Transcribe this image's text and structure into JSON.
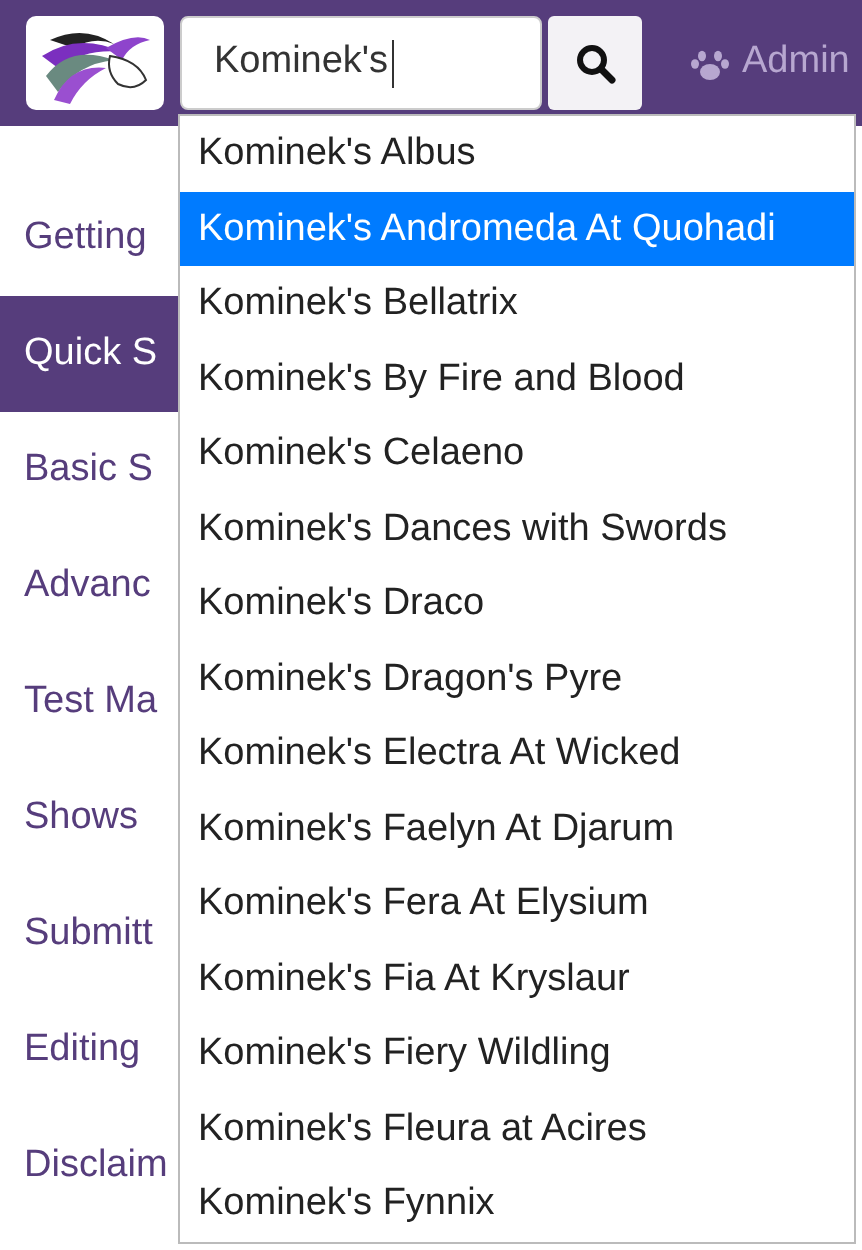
{
  "search": {
    "value": "Kominek's"
  },
  "nav_link": {
    "label": "Admin"
  },
  "sidebar": {
    "items": [
      {
        "label": "Getting",
        "selected": false
      },
      {
        "label": "Quick S",
        "selected": true
      },
      {
        "label": "Basic S",
        "selected": false
      },
      {
        "label": "Advanc",
        "selected": false
      },
      {
        "label": "Test Ma",
        "selected": false
      },
      {
        "label": "Shows",
        "selected": false
      },
      {
        "label": "Submitt",
        "selected": false
      },
      {
        "label": "Editing",
        "selected": false
      },
      {
        "label": "Disclaim",
        "selected": false
      }
    ]
  },
  "suggestions": [
    {
      "label": "Kominek's Albus",
      "selected": false
    },
    {
      "label": "Kominek's Andromeda At Quohadi",
      "selected": true
    },
    {
      "label": "Kominek's Bellatrix",
      "selected": false
    },
    {
      "label": "Kominek's By Fire and Blood",
      "selected": false
    },
    {
      "label": "Kominek's Celaeno",
      "selected": false
    },
    {
      "label": "Kominek's Dances with Swords",
      "selected": false
    },
    {
      "label": "Kominek's Draco",
      "selected": false
    },
    {
      "label": "Kominek's Dragon's Pyre",
      "selected": false
    },
    {
      "label": "Kominek's Electra At Wicked",
      "selected": false
    },
    {
      "label": "Kominek's Faelyn At Djarum",
      "selected": false
    },
    {
      "label": "Kominek's Fera At Elysium",
      "selected": false
    },
    {
      "label": "Kominek's Fia At Kryslaur",
      "selected": false
    },
    {
      "label": "Kominek's Fiery Wildling",
      "selected": false
    },
    {
      "label": "Kominek's Fleura at Acires",
      "selected": false
    },
    {
      "label": "Kominek's Fynnix",
      "selected": false
    }
  ]
}
